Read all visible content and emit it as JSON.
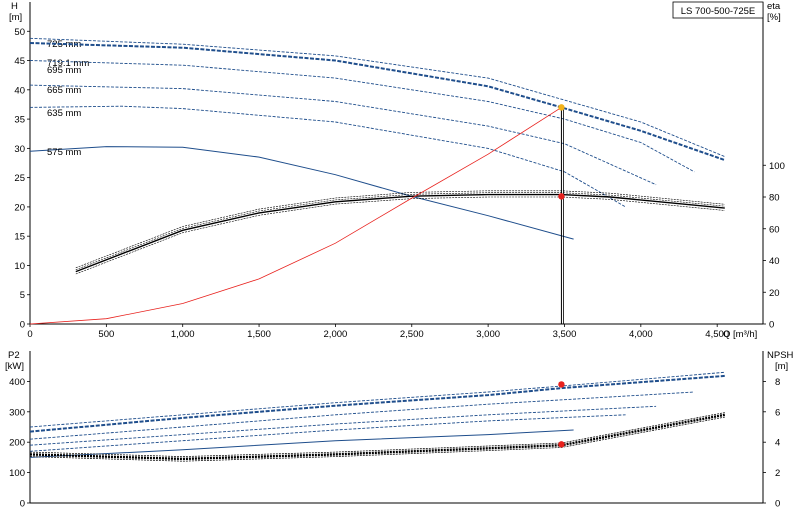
{
  "model_label": "LS 700-500-725E",
  "colors": {
    "curve_blue": "#1f4e8c",
    "eff_black": "#000000",
    "system_red": "#e8211d",
    "dot_red": "#e8211d",
    "dot_orange": "#f2b21a",
    "axis": "#000000"
  },
  "chart_data": [
    {
      "type": "line",
      "title": "",
      "xlabel": "Q [m³/h]",
      "ylabel": "H",
      "ylabel_unit": "[m]",
      "y2label": "eta",
      "y2label_unit": "[%]",
      "xlim": [
        0,
        4800
      ],
      "ylim": [
        0,
        55
      ],
      "y2lim": [
        0,
        100
      ],
      "x_ticks": [
        "0",
        "500",
        "1,000",
        "1,500",
        "2,000",
        "2,500",
        "3,000",
        "3,500",
        "4,000",
        "4,500"
      ],
      "x_tick_values": [
        0,
        500,
        1000,
        1500,
        2000,
        2500,
        3000,
        3500,
        4000,
        4500
      ],
      "y_ticks": [
        "0",
        "5",
        "10",
        "15",
        "20",
        "25",
        "30",
        "35",
        "40",
        "45",
        "50"
      ],
      "y_tick_values": [
        0,
        5,
        10,
        15,
        20,
        25,
        30,
        35,
        40,
        45,
        50
      ],
      "y2_ticks": [
        "0",
        "20",
        "40",
        "60",
        "80",
        "100"
      ],
      "y2_tick_values": [
        0,
        20,
        40,
        60,
        80,
        100
      ],
      "grid": false,
      "series": [
        {
          "name": "725 mm",
          "kind": "head",
          "style": "dashed",
          "x": [
            0,
            1000,
            2000,
            3000,
            3480,
            4000,
            4550
          ],
          "y": [
            48.8,
            47.8,
            45.8,
            42.0,
            38.4,
            34.5,
            28.6
          ]
        },
        {
          "name": "719.1 mm",
          "kind": "head",
          "style": "dashed-bold",
          "x": [
            0,
            1000,
            2000,
            3000,
            3480,
            4000,
            4550
          ],
          "y": [
            48.0,
            47.2,
            45.0,
            40.6,
            37.0,
            33.0,
            28.0
          ]
        },
        {
          "name": "695 mm",
          "kind": "head",
          "style": "dashed",
          "x": [
            0,
            1000,
            2000,
            3000,
            3500,
            4000,
            4350
          ],
          "y": [
            45.0,
            44.2,
            42.0,
            38.0,
            35.0,
            31.0,
            26.0
          ]
        },
        {
          "name": "665 mm",
          "kind": "head",
          "style": "dashed",
          "x": [
            0,
            1000,
            2000,
            3000,
            3500,
            4100
          ],
          "y": [
            40.8,
            40.2,
            38.0,
            33.8,
            30.8,
            23.8
          ]
        },
        {
          "name": "635 mm",
          "kind": "head",
          "style": "dashed",
          "x": [
            0,
            600,
            1000,
            2000,
            3000,
            3500,
            3900
          ],
          "y": [
            37.0,
            37.2,
            36.8,
            34.5,
            30.0,
            26.0,
            20.0
          ]
        },
        {
          "name": "575 mm",
          "kind": "head",
          "style": "solid",
          "x": [
            0,
            500,
            1000,
            1500,
            2000,
            2500,
            3000,
            3560
          ],
          "y": [
            29.5,
            30.3,
            30.2,
            28.5,
            25.5,
            21.8,
            18.5,
            14.5
          ]
        },
        {
          "name": "",
          "kind": "efficiency",
          "style": "solid",
          "x": [
            300,
            1000,
            1500,
            2000,
            2500,
            3000,
            3480,
            3800,
            4550
          ],
          "y2": [
            33,
            59,
            70,
            77,
            80.5,
            81.5,
            81.5,
            80,
            73
          ]
        },
        {
          "name": "",
          "kind": "system",
          "style": "solid",
          "x": [
            0,
            500,
            1000,
            1500,
            2000,
            2500,
            3000,
            3480
          ],
          "y": [
            0,
            0.9,
            3.5,
            7.7,
            13.8,
            21.5,
            29.0,
            37.0
          ]
        }
      ],
      "points": [
        {
          "label": "",
          "x": 3480,
          "y": 37.0,
          "color": "#f2b21a"
        },
        {
          "label": "",
          "x": 3480,
          "y2": 80.4,
          "color": "#e8211d"
        }
      ],
      "vertical_marker_x": 3480
    },
    {
      "type": "line",
      "title": "",
      "xlabel": "",
      "ylabel": "P2",
      "ylabel_unit": "[kW]",
      "y2label": "NPSH",
      "y2label_unit": "[m]",
      "xlim": [
        0,
        4800
      ],
      "ylim": [
        0,
        500
      ],
      "y2lim": [
        0,
        10
      ],
      "y_ticks": [
        "0",
        "100",
        "200",
        "300",
        "400"
      ],
      "y_tick_values": [
        0,
        100,
        200,
        300,
        400
      ],
      "y2_ticks": [
        "0",
        "2",
        "4",
        "6",
        "8"
      ],
      "y2_tick_values": [
        0,
        2,
        4,
        6,
        8
      ],
      "grid": false,
      "series": [
        {
          "name": "",
          "kind": "power-725",
          "style": "dashed",
          "x": [
            0,
            1000,
            2000,
            3000,
            3480,
            4550
          ],
          "y": [
            250,
            290,
            330,
            365,
            385,
            430
          ]
        },
        {
          "name": "",
          "kind": "power-719",
          "style": "dashed-bold",
          "x": [
            0,
            1000,
            2000,
            3000,
            3480,
            4550
          ],
          "y": [
            235,
            280,
            320,
            355,
            378,
            418
          ]
        },
        {
          "name": "",
          "kind": "power-695",
          "style": "dashed",
          "x": [
            0,
            1000,
            2000,
            3000,
            4350
          ],
          "y": [
            210,
            250,
            290,
            325,
            365
          ]
        },
        {
          "name": "",
          "kind": "power-665",
          "style": "dashed",
          "x": [
            0,
            1000,
            2000,
            3000,
            4100
          ],
          "y": [
            190,
            225,
            260,
            290,
            318
          ]
        },
        {
          "name": "",
          "kind": "power-635",
          "style": "dashed",
          "x": [
            0,
            1000,
            2000,
            3000,
            3900
          ],
          "y": [
            170,
            205,
            240,
            270,
            290
          ]
        },
        {
          "name": "",
          "kind": "power-575",
          "style": "solid",
          "x": [
            0,
            1000,
            2000,
            3000,
            3560
          ],
          "y": [
            150,
            175,
            205,
            225,
            240
          ]
        },
        {
          "name": "",
          "kind": "npsh",
          "style": "dashed-bold",
          "x": [
            0,
            1000,
            2000,
            3000,
            3480,
            4550
          ],
          "y2": [
            3.2,
            2.9,
            3.2,
            3.6,
            3.8,
            5.8
          ]
        }
      ],
      "points": [
        {
          "label": "",
          "x": 3480,
          "y": 390,
          "color": "#e8211d"
        },
        {
          "label": "",
          "x": 3480,
          "y": 193,
          "color": "#e8211d"
        }
      ]
    }
  ]
}
